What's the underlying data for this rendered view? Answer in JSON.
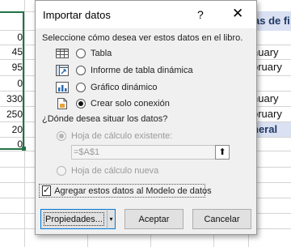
{
  "sheet": {
    "column_numbers": [
      "0",
      "45",
      "95",
      "0",
      "330",
      "250",
      "20",
      "0"
    ],
    "right_header": "as de fi",
    "right_cells": [
      "nuary",
      "bruary",
      "",
      "nuary",
      "bruary"
    ],
    "right_bold_cell": "neral"
  },
  "dialog": {
    "title": "Importar datos",
    "help_glyph": "?",
    "close_glyph": "✕",
    "prompt": "Seleccione cómo desea ver estos datos en el libro.",
    "view_options": [
      {
        "icon": "table-icon",
        "label": "Tabla",
        "selected": false
      },
      {
        "icon": "pivot-table-icon",
        "label": "Informe de tabla dinámica",
        "selected": false
      },
      {
        "icon": "pivot-chart-icon",
        "label": "Gráfico dinámico",
        "selected": false
      },
      {
        "icon": "connection-icon",
        "label": "Crear solo conexión",
        "selected": true
      }
    ],
    "where_prompt": "¿Dónde desea situar los datos?",
    "where_options": [
      {
        "label": "Hoja de cálculo existente:",
        "selected": true,
        "disabled": true
      },
      {
        "label": "Hoja de cálculo nueva",
        "selected": false,
        "disabled": true
      }
    ],
    "reference_value": "=$A$1",
    "collapse_glyph": "⬆",
    "data_model_checkbox": {
      "label": "Agregar estos datos al Modelo de datos",
      "checked": true,
      "glyph": "✓"
    },
    "buttons": {
      "properties": "Propiedades...",
      "properties_arrow": "▾",
      "ok": "Aceptar",
      "cancel": "Cancelar"
    }
  }
}
